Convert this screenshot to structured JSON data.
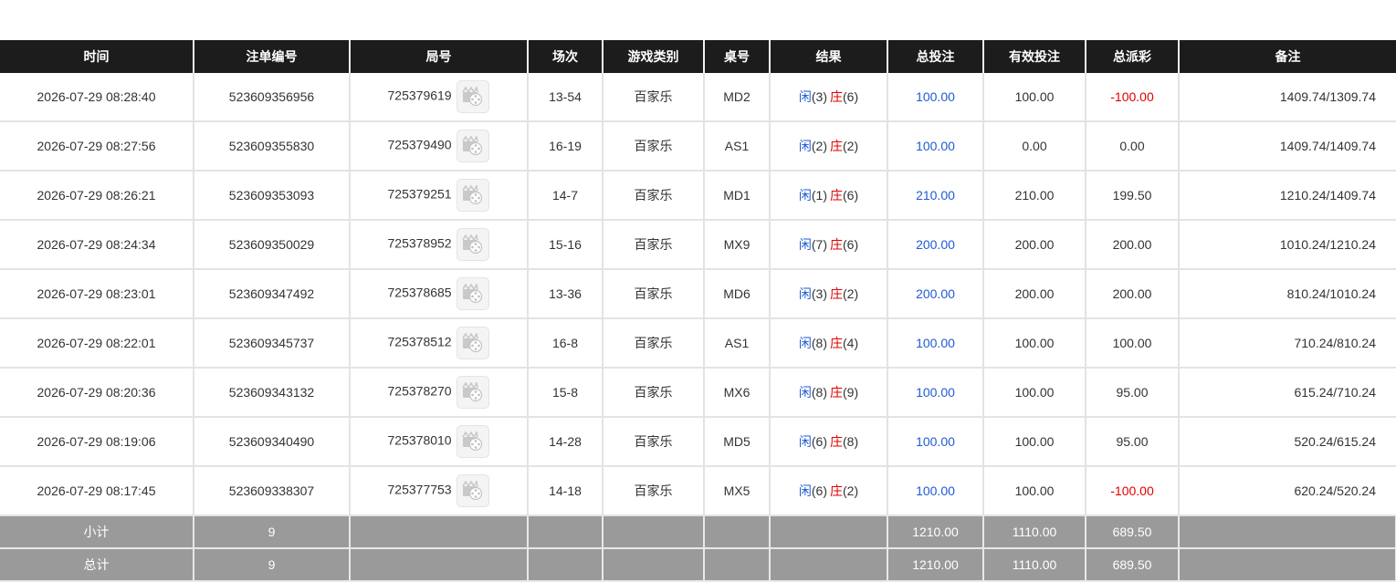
{
  "columns": [
    "时间",
    "注单编号",
    "局号",
    "场次",
    "游戏类别",
    "桌号",
    "结果",
    "总投注",
    "有效投注",
    "总派彩",
    "备注"
  ],
  "rows": [
    {
      "time": "2026-07-29 08:28:40",
      "bet_id": "523609356956",
      "round": "725379619",
      "shoe": "13-54",
      "game": "百家乐",
      "table": "MD2",
      "p_label": "闲",
      "p_val": "(3)",
      "b_label": "庄",
      "b_val": "(6)",
      "total": "100.00",
      "valid": "100.00",
      "payout": "-100.00",
      "payout_neg": true,
      "note": "1409.74/1309.74"
    },
    {
      "time": "2026-07-29 08:27:56",
      "bet_id": "523609355830",
      "round": "725379490",
      "shoe": "16-19",
      "game": "百家乐",
      "table": "AS1",
      "p_label": "闲",
      "p_val": "(2)",
      "b_label": "庄",
      "b_val": "(2)",
      "total": "100.00",
      "valid": "0.00",
      "payout": "0.00",
      "payout_neg": false,
      "note": "1409.74/1409.74"
    },
    {
      "time": "2026-07-29 08:26:21",
      "bet_id": "523609353093",
      "round": "725379251",
      "shoe": "14-7",
      "game": "百家乐",
      "table": "MD1",
      "p_label": "闲",
      "p_val": "(1)",
      "b_label": "庄",
      "b_val": "(6)",
      "total": "210.00",
      "valid": "210.00",
      "payout": "199.50",
      "payout_neg": false,
      "note": "1210.24/1409.74"
    },
    {
      "time": "2026-07-29 08:24:34",
      "bet_id": "523609350029",
      "round": "725378952",
      "shoe": "15-16",
      "game": "百家乐",
      "table": "MX9",
      "p_label": "闲",
      "p_val": "(7)",
      "b_label": "庄",
      "b_val": "(6)",
      "total": "200.00",
      "valid": "200.00",
      "payout": "200.00",
      "payout_neg": false,
      "note": "1010.24/1210.24"
    },
    {
      "time": "2026-07-29 08:23:01",
      "bet_id": "523609347492",
      "round": "725378685",
      "shoe": "13-36",
      "game": "百家乐",
      "table": "MD6",
      "p_label": "闲",
      "p_val": "(3)",
      "b_label": "庄",
      "b_val": "(2)",
      "total": "200.00",
      "valid": "200.00",
      "payout": "200.00",
      "payout_neg": false,
      "note": "810.24/1010.24"
    },
    {
      "time": "2026-07-29 08:22:01",
      "bet_id": "523609345737",
      "round": "725378512",
      "shoe": "16-8",
      "game": "百家乐",
      "table": "AS1",
      "p_label": "闲",
      "p_val": "(8)",
      "b_label": "庄",
      "b_val": "(4)",
      "total": "100.00",
      "valid": "100.00",
      "payout": "100.00",
      "payout_neg": false,
      "note": "710.24/810.24"
    },
    {
      "time": "2026-07-29 08:20:36",
      "bet_id": "523609343132",
      "round": "725378270",
      "shoe": "15-8",
      "game": "百家乐",
      "table": "MX6",
      "p_label": "闲",
      "p_val": "(8)",
      "b_label": "庄",
      "b_val": "(9)",
      "total": "100.00",
      "valid": "100.00",
      "payout": "95.00",
      "payout_neg": false,
      "note": "615.24/710.24"
    },
    {
      "time": "2026-07-29 08:19:06",
      "bet_id": "523609340490",
      "round": "725378010",
      "shoe": "14-28",
      "game": "百家乐",
      "table": "MD5",
      "p_label": "闲",
      "p_val": "(6)",
      "b_label": "庄",
      "b_val": "(8)",
      "total": "100.00",
      "valid": "100.00",
      "payout": "95.00",
      "payout_neg": false,
      "note": "520.24/615.24"
    },
    {
      "time": "2026-07-29 08:17:45",
      "bet_id": "523609338307",
      "round": "725377753",
      "shoe": "14-18",
      "game": "百家乐",
      "table": "MX5",
      "p_label": "闲",
      "p_val": "(6)",
      "b_label": "庄",
      "b_val": "(2)",
      "total": "100.00",
      "valid": "100.00",
      "payout": "-100.00",
      "payout_neg": true,
      "note": "620.24/520.24"
    }
  ],
  "subtotal": {
    "label": "小计",
    "count": "9",
    "total": "1210.00",
    "valid": "1110.00",
    "payout": "689.50"
  },
  "grand_total": {
    "label": "总计",
    "count": "9",
    "total": "1210.00",
    "valid": "1110.00",
    "payout": "689.50"
  },
  "icons": {
    "replay": "video-replay-icon"
  },
  "colors": {
    "header_bg": "#1c1c1c",
    "total_row_bg": "#9a9a9a",
    "blue": "#1e5bd6",
    "red": "#e00000"
  }
}
